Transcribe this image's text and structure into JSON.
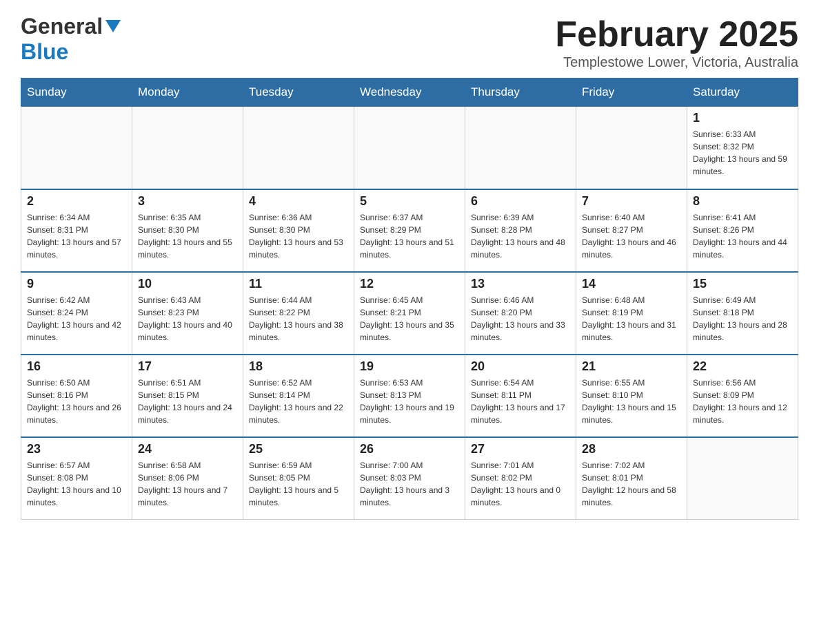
{
  "header": {
    "logo_main": "General",
    "logo_blue": "Blue",
    "title": "February 2025",
    "subtitle": "Templestowe Lower, Victoria, Australia"
  },
  "calendar": {
    "days_of_week": [
      "Sunday",
      "Monday",
      "Tuesday",
      "Wednesday",
      "Thursday",
      "Friday",
      "Saturday"
    ],
    "weeks": [
      [
        {
          "day": "",
          "info": ""
        },
        {
          "day": "",
          "info": ""
        },
        {
          "day": "",
          "info": ""
        },
        {
          "day": "",
          "info": ""
        },
        {
          "day": "",
          "info": ""
        },
        {
          "day": "",
          "info": ""
        },
        {
          "day": "1",
          "info": "Sunrise: 6:33 AM\nSunset: 8:32 PM\nDaylight: 13 hours and 59 minutes."
        }
      ],
      [
        {
          "day": "2",
          "info": "Sunrise: 6:34 AM\nSunset: 8:31 PM\nDaylight: 13 hours and 57 minutes."
        },
        {
          "day": "3",
          "info": "Sunrise: 6:35 AM\nSunset: 8:30 PM\nDaylight: 13 hours and 55 minutes."
        },
        {
          "day": "4",
          "info": "Sunrise: 6:36 AM\nSunset: 8:30 PM\nDaylight: 13 hours and 53 minutes."
        },
        {
          "day": "5",
          "info": "Sunrise: 6:37 AM\nSunset: 8:29 PM\nDaylight: 13 hours and 51 minutes."
        },
        {
          "day": "6",
          "info": "Sunrise: 6:39 AM\nSunset: 8:28 PM\nDaylight: 13 hours and 48 minutes."
        },
        {
          "day": "7",
          "info": "Sunrise: 6:40 AM\nSunset: 8:27 PM\nDaylight: 13 hours and 46 minutes."
        },
        {
          "day": "8",
          "info": "Sunrise: 6:41 AM\nSunset: 8:26 PM\nDaylight: 13 hours and 44 minutes."
        }
      ],
      [
        {
          "day": "9",
          "info": "Sunrise: 6:42 AM\nSunset: 8:24 PM\nDaylight: 13 hours and 42 minutes."
        },
        {
          "day": "10",
          "info": "Sunrise: 6:43 AM\nSunset: 8:23 PM\nDaylight: 13 hours and 40 minutes."
        },
        {
          "day": "11",
          "info": "Sunrise: 6:44 AM\nSunset: 8:22 PM\nDaylight: 13 hours and 38 minutes."
        },
        {
          "day": "12",
          "info": "Sunrise: 6:45 AM\nSunset: 8:21 PM\nDaylight: 13 hours and 35 minutes."
        },
        {
          "day": "13",
          "info": "Sunrise: 6:46 AM\nSunset: 8:20 PM\nDaylight: 13 hours and 33 minutes."
        },
        {
          "day": "14",
          "info": "Sunrise: 6:48 AM\nSunset: 8:19 PM\nDaylight: 13 hours and 31 minutes."
        },
        {
          "day": "15",
          "info": "Sunrise: 6:49 AM\nSunset: 8:18 PM\nDaylight: 13 hours and 28 minutes."
        }
      ],
      [
        {
          "day": "16",
          "info": "Sunrise: 6:50 AM\nSunset: 8:16 PM\nDaylight: 13 hours and 26 minutes."
        },
        {
          "day": "17",
          "info": "Sunrise: 6:51 AM\nSunset: 8:15 PM\nDaylight: 13 hours and 24 minutes."
        },
        {
          "day": "18",
          "info": "Sunrise: 6:52 AM\nSunset: 8:14 PM\nDaylight: 13 hours and 22 minutes."
        },
        {
          "day": "19",
          "info": "Sunrise: 6:53 AM\nSunset: 8:13 PM\nDaylight: 13 hours and 19 minutes."
        },
        {
          "day": "20",
          "info": "Sunrise: 6:54 AM\nSunset: 8:11 PM\nDaylight: 13 hours and 17 minutes."
        },
        {
          "day": "21",
          "info": "Sunrise: 6:55 AM\nSunset: 8:10 PM\nDaylight: 13 hours and 15 minutes."
        },
        {
          "day": "22",
          "info": "Sunrise: 6:56 AM\nSunset: 8:09 PM\nDaylight: 13 hours and 12 minutes."
        }
      ],
      [
        {
          "day": "23",
          "info": "Sunrise: 6:57 AM\nSunset: 8:08 PM\nDaylight: 13 hours and 10 minutes."
        },
        {
          "day": "24",
          "info": "Sunrise: 6:58 AM\nSunset: 8:06 PM\nDaylight: 13 hours and 7 minutes."
        },
        {
          "day": "25",
          "info": "Sunrise: 6:59 AM\nSunset: 8:05 PM\nDaylight: 13 hours and 5 minutes."
        },
        {
          "day": "26",
          "info": "Sunrise: 7:00 AM\nSunset: 8:03 PM\nDaylight: 13 hours and 3 minutes."
        },
        {
          "day": "27",
          "info": "Sunrise: 7:01 AM\nSunset: 8:02 PM\nDaylight: 13 hours and 0 minutes."
        },
        {
          "day": "28",
          "info": "Sunrise: 7:02 AM\nSunset: 8:01 PM\nDaylight: 12 hours and 58 minutes."
        },
        {
          "day": "",
          "info": ""
        }
      ]
    ]
  }
}
